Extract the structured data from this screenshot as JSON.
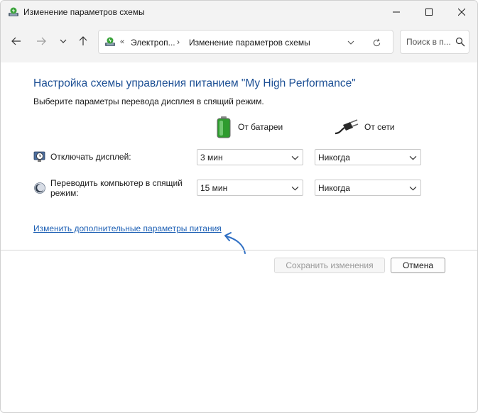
{
  "window": {
    "title": "Изменение параметров схемы",
    "controls": {
      "minimize": "minimize-icon",
      "maximize": "maximize-icon",
      "close": "close-icon"
    }
  },
  "nav": {
    "back": "arrow-left-icon",
    "forward": "arrow-right-icon",
    "recent": "chevron-down-icon",
    "up": "arrow-up-icon"
  },
  "address": {
    "overflow": "«",
    "crumbs": [
      "Электроп...",
      "Изменение параметров схемы"
    ],
    "separator": "›"
  },
  "search": {
    "placeholder": "Поиск в п..."
  },
  "content": {
    "heading": "Настройка схемы управления питанием \"My High Performance\"",
    "subheading": "Выберите параметры перевода дисплея в спящий режим.",
    "columns": {
      "battery": "От батареи",
      "ac": "От сети"
    },
    "rows": [
      {
        "label": "Отключать дисплей:",
        "battery": "3 мин",
        "ac": "Никогда"
      },
      {
        "label_line1": "Переводить компьютер в спящий",
        "label_line2": "режим:",
        "battery": "15 мин",
        "ac": "Никогда"
      }
    ],
    "advanced_link": "Изменить дополнительные параметры питания"
  },
  "buttons": {
    "save": "Сохранить изменения",
    "cancel": "Отмена"
  },
  "colors": {
    "heading": "#1c4f94",
    "link": "#1c5fb4",
    "annotation_arrow": "#2f6fc4"
  }
}
